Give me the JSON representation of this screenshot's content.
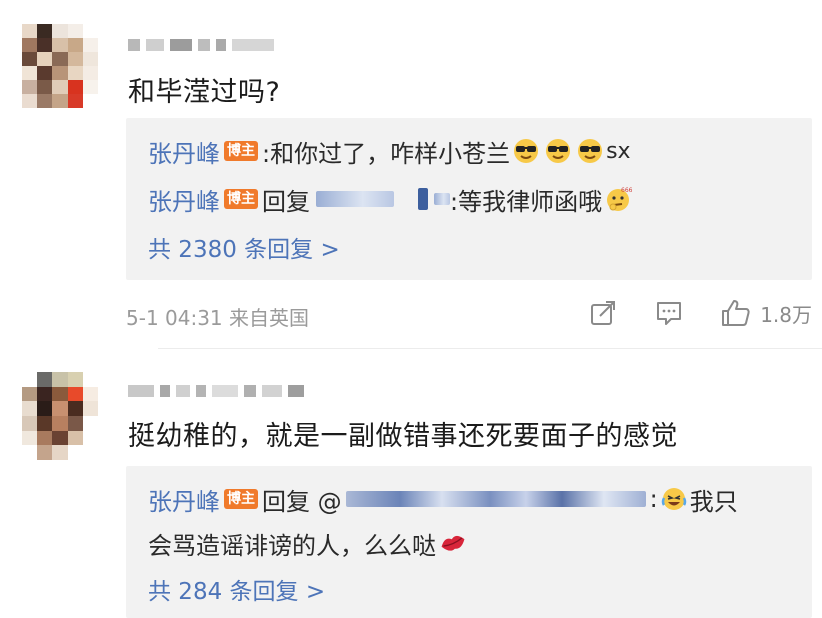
{
  "comments": [
    {
      "text": "和毕滢过吗?",
      "replies": [
        {
          "author": "张丹峰",
          "badge": "博主",
          "prefix": "",
          "text": ":和你过了，咋样小苍兰",
          "suffix": "sx",
          "emoji": [
            "sunglasses-emoji",
            "sunglasses-emoji",
            "sunglasses-emoji"
          ]
        },
        {
          "author": "张丹峰",
          "badge": "博主",
          "prefix": "回复",
          "text": ":等我律师函哦",
          "suffix": "",
          "emoji": [
            "thinking-emoji"
          ]
        }
      ],
      "more_replies": "共 2380 条回复 >",
      "meta": "5-1 04:31  来自英国",
      "like_count": "1.8万"
    },
    {
      "text": "挺幼稚的，就是一副做错事还死要面子的感觉",
      "replies": [
        {
          "author": "张丹峰",
          "badge": "博主",
          "prefix": "回复 @",
          "text": ":",
          "text2": "我只",
          "line2": "会骂造谣诽谤的人，么么哒",
          "emoji": [
            "laughing-crying-emoji"
          ],
          "emoji2": [
            "kiss-lips-emoji"
          ]
        }
      ],
      "more_replies": "共 284 条回复 >"
    }
  ],
  "colors": {
    "link": "#4d74b8",
    "badge": "#f07a2b",
    "reply_bg": "#f2f2f2",
    "meta": "#9a9a9a"
  }
}
